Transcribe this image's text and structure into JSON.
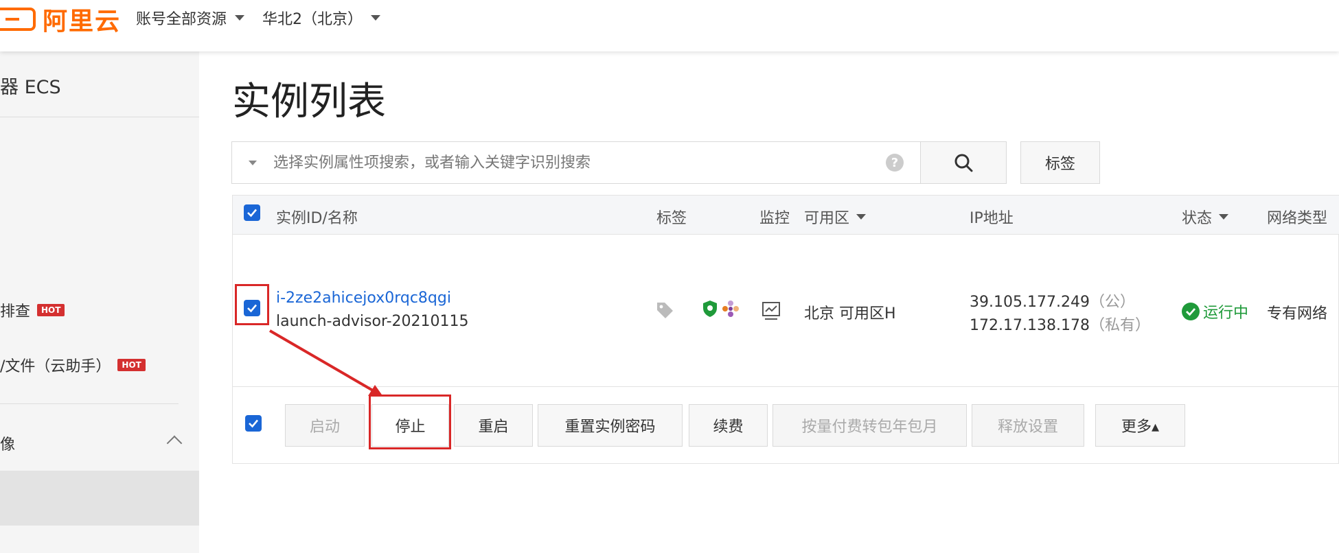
{
  "topbar": {
    "logo_text": "阿里云",
    "account_scope": "账号全部资源",
    "region": "华北2（北京）"
  },
  "sidebar": {
    "title": "器 ECS",
    "items": [
      {
        "label": "排查",
        "badge": "HOT"
      },
      {
        "label": "/文件（云助手）",
        "badge": "HOT"
      },
      {
        "label": "像"
      }
    ]
  },
  "page": {
    "title": "实例列表"
  },
  "search": {
    "placeholder": "选择实例属性项搜索，或者输入关键字识别搜索",
    "help": "?",
    "tag_button": "标签"
  },
  "table": {
    "columns": [
      "实例ID/名称",
      "标签",
      "监控",
      "可用区",
      "IP地址",
      "状态",
      "网络类型"
    ],
    "rows": [
      {
        "id": "i-2ze2ahicejox0rqc8qgi",
        "name": "launch-advisor-20210115",
        "zone": "北京 可用区H",
        "ip_public": "39.105.177.249",
        "ip_public_tag": "（公）",
        "ip_private": "172.17.138.178",
        "ip_private_tag": "（私有）",
        "status": "运行中",
        "network": "专有网络"
      }
    ]
  },
  "actions": {
    "start": "启动",
    "stop": "停止",
    "restart": "重启",
    "reset_password": "重置实例密码",
    "renew": "续费",
    "convert": "按量付费转包年包月",
    "release": "释放设置",
    "more": "更多▴"
  },
  "colors": {
    "brand": "#ff6a00",
    "link": "#1a66d6",
    "running": "#1f9a3a",
    "highlight": "#d92727"
  }
}
